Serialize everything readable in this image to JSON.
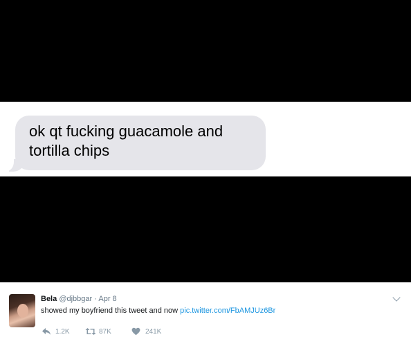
{
  "message": {
    "text": "ok qt fucking guacamole and\ntortilla chips"
  },
  "tweet": {
    "name": "Bela",
    "handle": "@djbbgar",
    "separator": "·",
    "date": "Apr 8",
    "body_text": "showed my boyfriend this tweet and now",
    "link_text": "pic.twitter.com/FbAMJUz6Br",
    "actions": {
      "reply_count": "1.2K",
      "retweet_count": "87K",
      "like_count": "241K"
    },
    "icons": {
      "avatar": "profile-photo",
      "menu": "chevron-down-icon",
      "reply": "reply-icon",
      "retweet": "retweet-icon",
      "like": "heart-icon"
    },
    "colors": {
      "link": "#1b95e0",
      "muted": "#657786",
      "bubble": "#e5e5ea"
    }
  }
}
